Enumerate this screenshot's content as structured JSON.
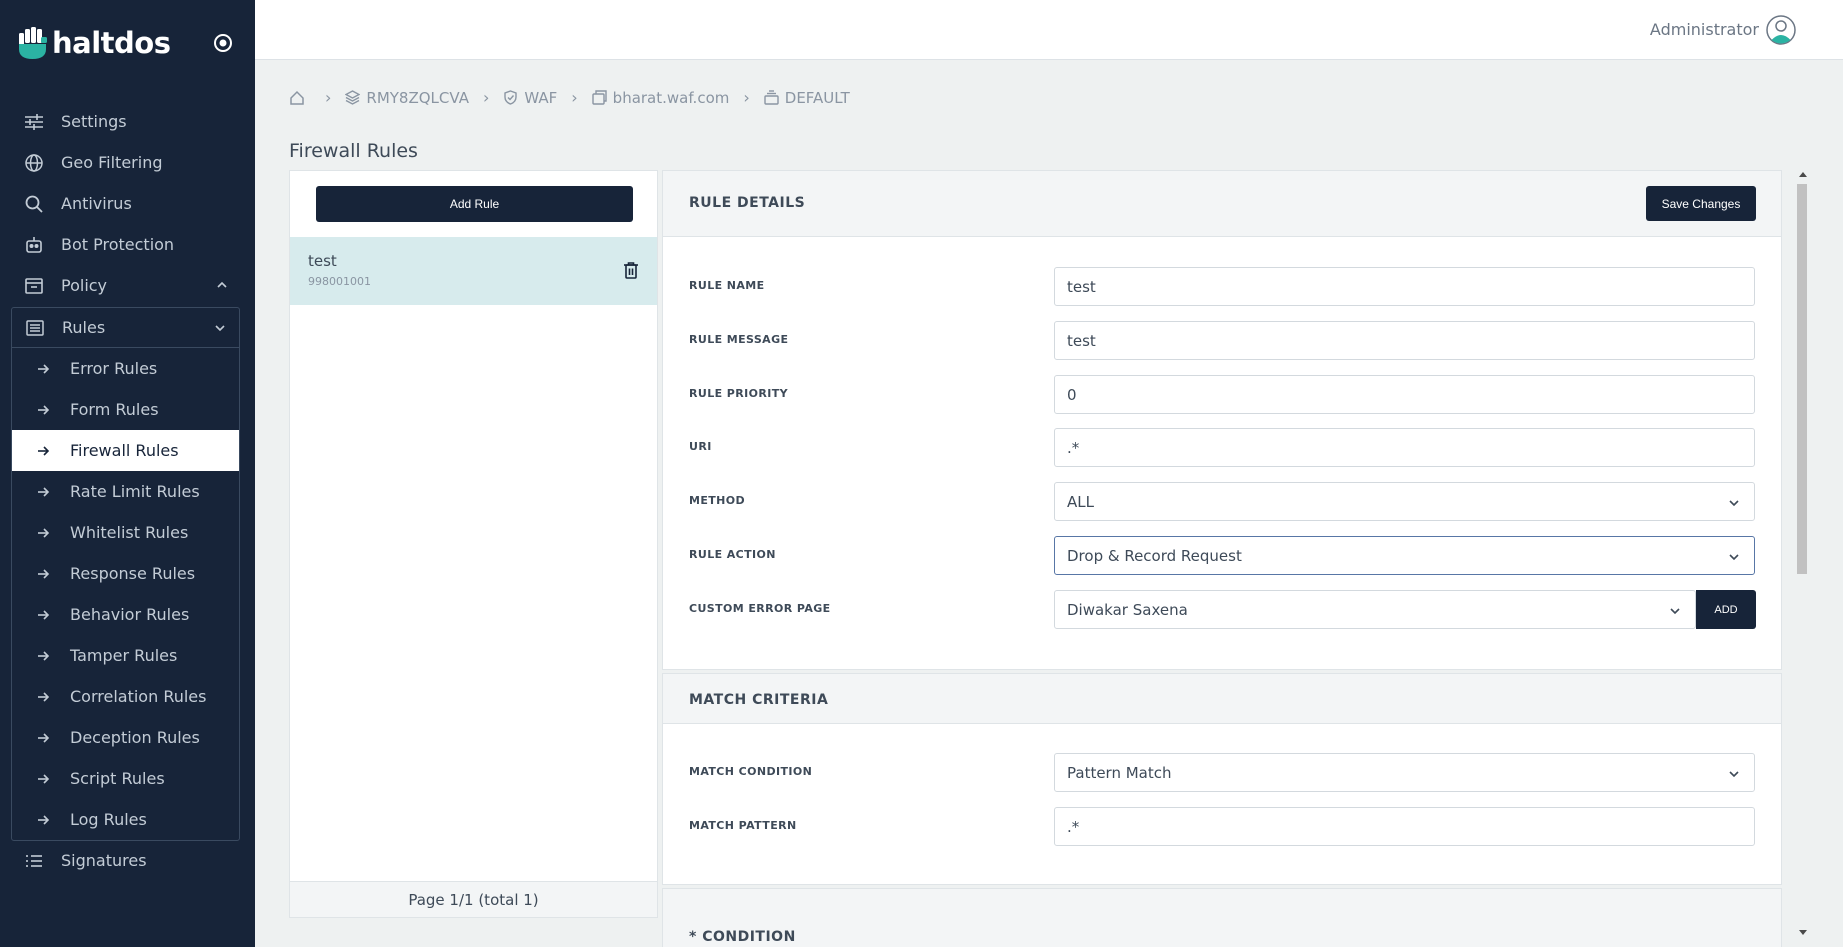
{
  "app": {
    "brand": "haltdos"
  },
  "sidebar": {
    "items": [
      {
        "label": "Settings",
        "icon": "sliders-icon"
      },
      {
        "label": "Geo Filtering",
        "icon": "globe-icon"
      },
      {
        "label": "Antivirus",
        "icon": "search-icon"
      },
      {
        "label": "Bot Protection",
        "icon": "robot-icon"
      },
      {
        "label": "Policy",
        "icon": "inbox-icon"
      }
    ],
    "rules_label": "Rules",
    "rules_items": [
      {
        "label": "Error Rules"
      },
      {
        "label": "Form Rules"
      },
      {
        "label": "Firewall Rules",
        "active": true
      },
      {
        "label": "Rate Limit Rules"
      },
      {
        "label": "Whitelist Rules"
      },
      {
        "label": "Response Rules"
      },
      {
        "label": "Behavior Rules"
      },
      {
        "label": "Tamper Rules"
      },
      {
        "label": "Correlation Rules"
      },
      {
        "label": "Deception Rules"
      },
      {
        "label": "Script Rules"
      },
      {
        "label": "Log Rules"
      }
    ],
    "signatures_label": "Signatures"
  },
  "header": {
    "user": "Administrator"
  },
  "breadcrumb": {
    "home_icon": "home-icon",
    "items": [
      "RMY8ZQLCVA",
      "WAF",
      "bharat.waf.com",
      "DEFAULT"
    ]
  },
  "page": {
    "title": "Firewall Rules"
  },
  "rule_list": {
    "add_label": "Add Rule",
    "items": [
      {
        "name": "test",
        "id": "998001001"
      }
    ],
    "pagination": "Page 1/1 (total 1)"
  },
  "details": {
    "title": "RULE DETAILS",
    "save_label": "Save Changes",
    "fields": {
      "rule_name": {
        "label": "RULE NAME",
        "value": "test"
      },
      "rule_message": {
        "label": "RULE MESSAGE",
        "value": "test"
      },
      "rule_priority": {
        "label": "RULE PRIORITY",
        "value": "0"
      },
      "uri": {
        "label": "URI",
        "value": ".*"
      },
      "method": {
        "label": "METHOD",
        "value": "ALL"
      },
      "rule_action": {
        "label": "RULE ACTION",
        "value": "Drop & Record Request"
      },
      "custom_error_page": {
        "label": "CUSTOM ERROR PAGE",
        "value": "Diwakar Saxena"
      }
    },
    "add_label": "ADD"
  },
  "match": {
    "title": "MATCH CRITERIA",
    "condition": {
      "label": "MATCH CONDITION",
      "value": "Pattern Match"
    },
    "pattern": {
      "label": "MATCH PATTERN",
      "value": ".*"
    }
  },
  "condition_panel": {
    "title": "* CONDITION"
  },
  "colors": {
    "sidebar_bg": "#172439",
    "active_row": "#d7ebed",
    "button_bg": "#172439",
    "logo_accent": "#2bb3a3"
  }
}
